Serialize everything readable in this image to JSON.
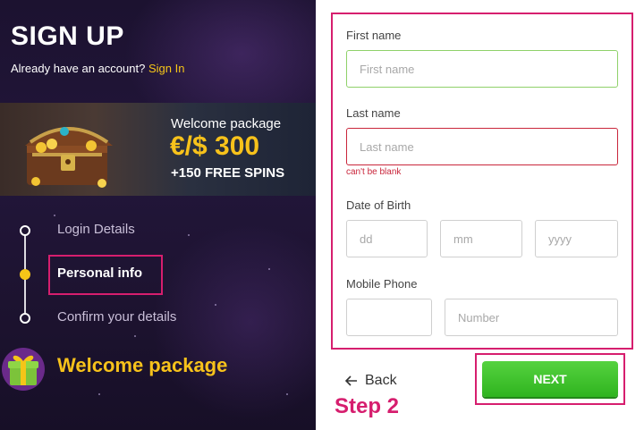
{
  "header": {
    "title": "SIGN UP",
    "account_prompt": "Already have an account?",
    "signin_link": "Sign In"
  },
  "banner": {
    "label": "Welcome package",
    "amount": "€/$ 300",
    "spins": "+150 FREE SPINS"
  },
  "steps": [
    {
      "label": "Login Details",
      "active": false
    },
    {
      "label": "Personal info",
      "active": true
    },
    {
      "label": "Confirm your details",
      "active": false
    }
  ],
  "welcome_package": "Welcome package",
  "form": {
    "first_name": {
      "label": "First name",
      "placeholder": "First name",
      "value": ""
    },
    "last_name": {
      "label": "Last name",
      "placeholder": "Last name",
      "value": "",
      "error": "can't be blank"
    },
    "dob": {
      "label": "Date of Birth",
      "day_placeholder": "dd",
      "month_placeholder": "mm",
      "year_placeholder": "yyyy"
    },
    "phone": {
      "label": "Mobile Phone",
      "code_placeholder": "",
      "number_placeholder": "Number"
    }
  },
  "actions": {
    "back_label": "Back",
    "next_label": "NEXT"
  },
  "annotation": "Step 2",
  "colors": {
    "accent_yellow": "#f5c518",
    "highlight_pink": "#d61e6e",
    "next_green": "#3cbf2a",
    "error_red": "#c9263b",
    "valid_green": "#8fd16a"
  }
}
